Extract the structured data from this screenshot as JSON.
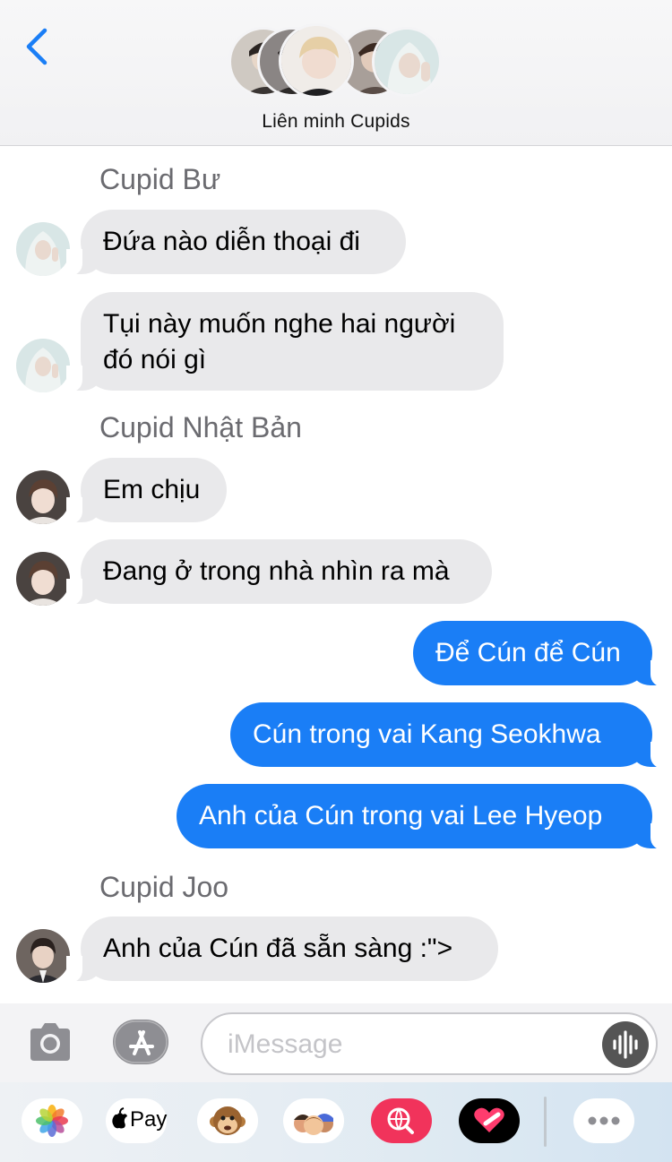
{
  "header": {
    "group_name": "Liên minh Cupids",
    "back_icon": "chevron-left-icon"
  },
  "messages": [
    {
      "sender": "Cupid Bư"
    },
    {
      "text": "Đứa nào diễn thoại đi"
    },
    {
      "text": "Tụi này muốn nghe hai người đó nói gì"
    },
    {
      "sender": "Cupid Nhật Bản"
    },
    {
      "text": "Em chịu"
    },
    {
      "text": "Đang ở trong nhà nhìn ra mà"
    },
    {
      "text": "Để Cún để Cún"
    },
    {
      "text": "Cún trong vai Kang Seokhwa"
    },
    {
      "text": "Anh của Cún trong vai Lee Hyeop"
    },
    {
      "sender": "Cupid Joo"
    },
    {
      "text": "Anh của Cún đã sẵn sàng :\">"
    }
  ],
  "input": {
    "placeholder": "iMessage",
    "value": ""
  },
  "apps": {
    "pay_label": "Pay",
    "icons": [
      "photos-icon",
      "apple-pay-icon",
      "animoji-icon",
      "memoji-icon",
      "web-search-icon",
      "digital-touch-icon",
      "more-icon"
    ]
  },
  "colors": {
    "accent": "#1a7ef6",
    "incoming_bubble": "#e9e9eb"
  }
}
